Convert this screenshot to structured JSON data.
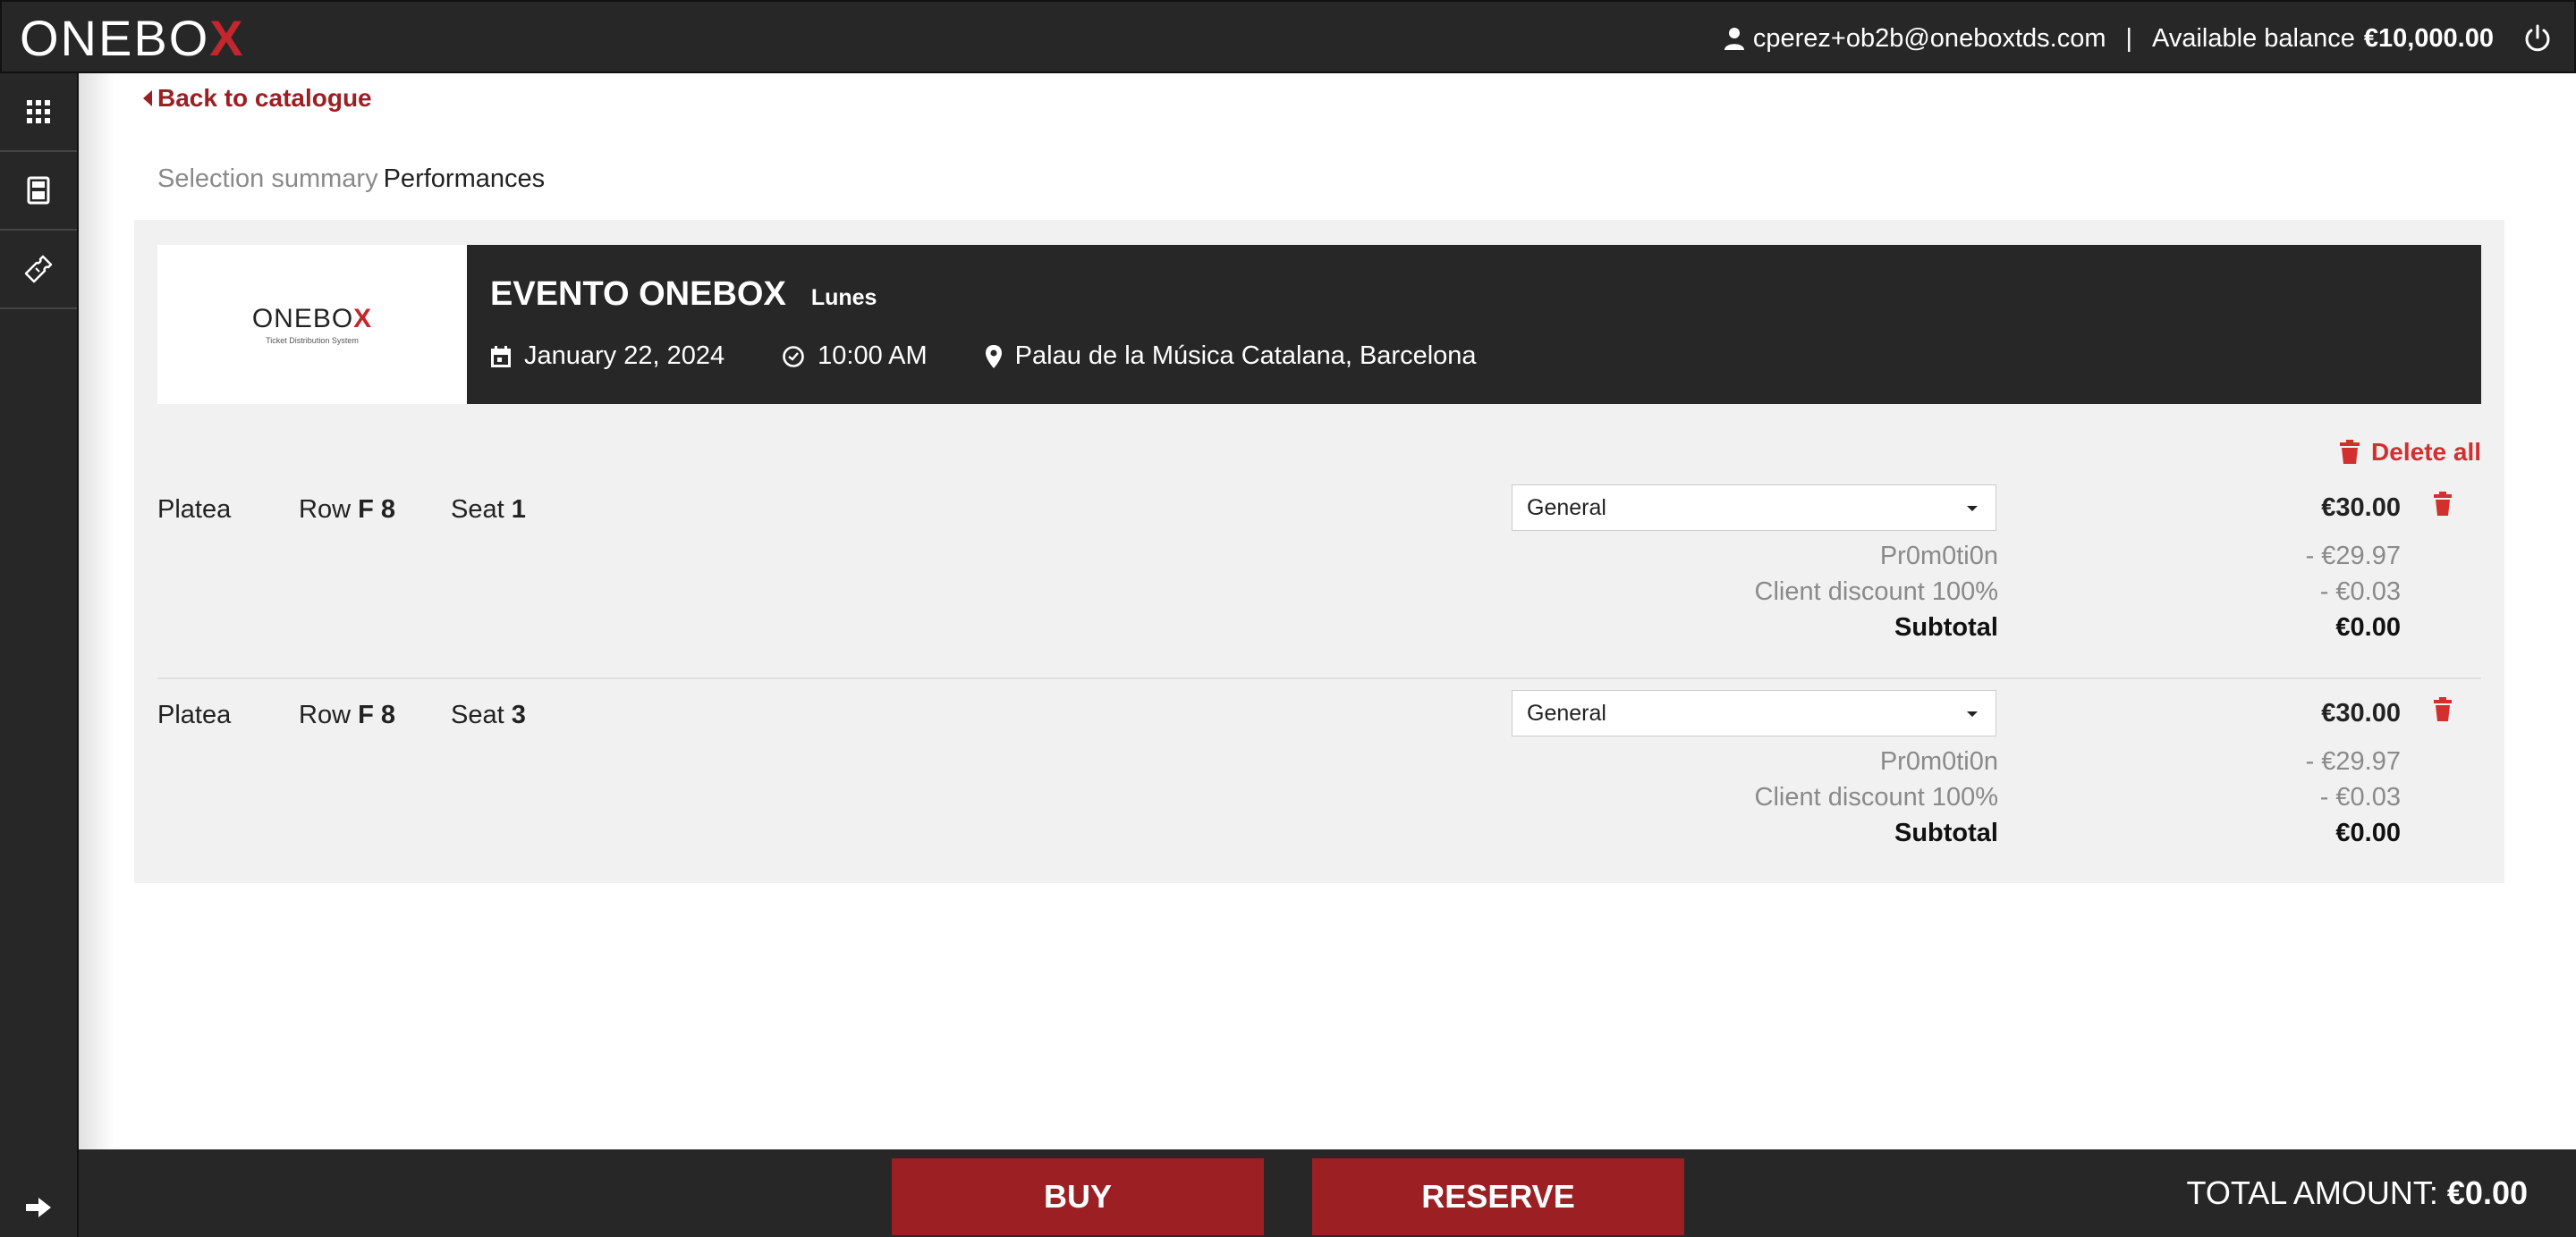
{
  "header": {
    "logo": "ONEBO",
    "logo_x": "X",
    "user_email": "cperez+ob2b@oneboxtds.com",
    "separator": "|",
    "balance_label": "Available balance",
    "balance_value": "€10,000.00"
  },
  "sidebar": {
    "items": [
      {
        "icon": "apps-grid-icon"
      },
      {
        "icon": "calculator-icon"
      },
      {
        "icon": "ticket-icon"
      }
    ],
    "bottom_icon": "arrow-right-icon"
  },
  "back_link": "Back to catalogue",
  "breadcrumb": {
    "parent": "Selection summary",
    "current": "Performances"
  },
  "event": {
    "logo_text": "ONEBO",
    "logo_x": "X",
    "logo_sub": "Ticket Distribution System",
    "title": "EVENTO ONEBOX",
    "tag": "Lunes",
    "date": "January 22, 2024",
    "time": "10:00 AM",
    "venue": "Palau de la Música Catalana, Barcelona"
  },
  "delete_all": "Delete all",
  "tickets": [
    {
      "zone": "Platea",
      "row_label": "Row",
      "row_value": "F 8",
      "seat_label": "Seat",
      "seat_value": "1",
      "rate": "General",
      "price": "€30.00",
      "promo_label": "Pr0m0ti0n",
      "promo_value": "- €29.97",
      "discount_label": "Client discount 100%",
      "discount_value": "- €0.03",
      "subtotal_label": "Subtotal",
      "subtotal_value": "€0.00"
    },
    {
      "zone": "Platea",
      "row_label": "Row",
      "row_value": "F 8",
      "seat_label": "Seat",
      "seat_value": "3",
      "rate": "General",
      "price": "€30.00",
      "promo_label": "Pr0m0ti0n",
      "promo_value": "- €29.97",
      "discount_label": "Client discount 100%",
      "discount_value": "- €0.03",
      "subtotal_label": "Subtotal",
      "subtotal_value": "€0.00"
    }
  ],
  "footer": {
    "buy_label": "BUY",
    "reserve_label": "RESERVE",
    "total_label": "TOTAL AMOUNT:",
    "total_value": "€0.00"
  },
  "colors": {
    "brand_red": "#9c1f24",
    "delete_red": "#d32f2f",
    "dark_bar": "#272727",
    "panel_bg": "#f1f1f1"
  }
}
